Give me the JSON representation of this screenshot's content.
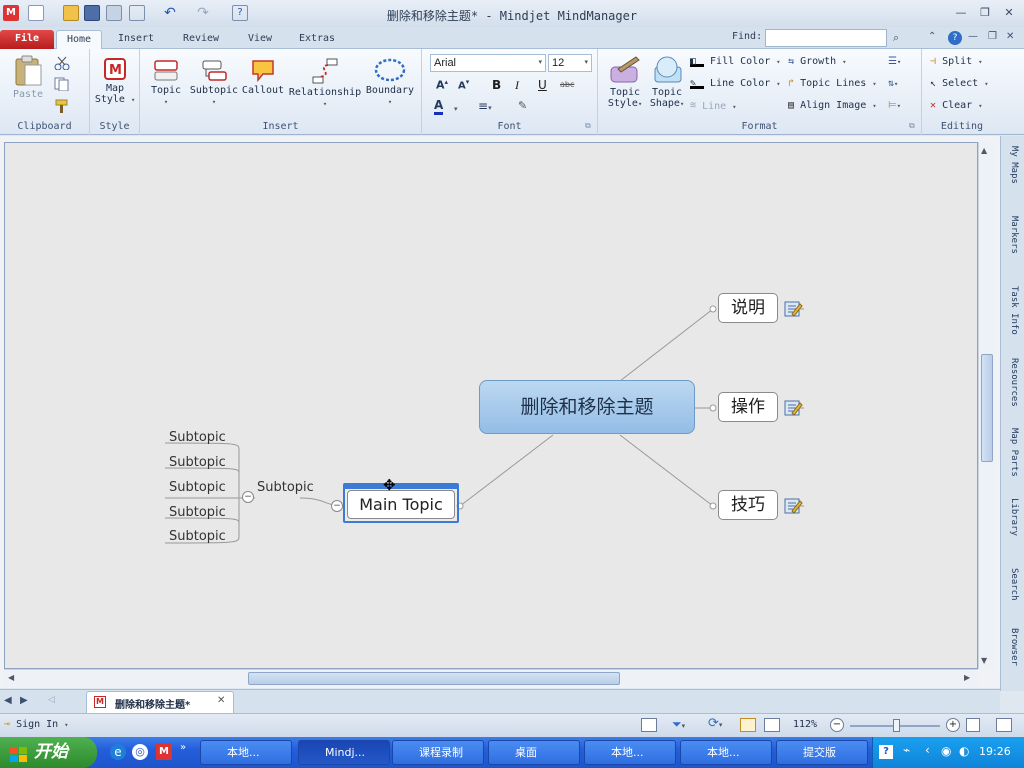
{
  "titlebar": {
    "title": "删除和移除主题* - Mindjet MindManager"
  },
  "tabs": [
    "File",
    "Home",
    "Insert",
    "Review",
    "View",
    "Extras"
  ],
  "find": {
    "label": "Find:",
    "value": ""
  },
  "ribbon": {
    "clipboard": {
      "label": "Clipboard",
      "paste": "Paste"
    },
    "style": {
      "label": "Style",
      "map_style": "Map Style"
    },
    "insert": {
      "label": "Insert",
      "buttons": [
        "Topic",
        "Subtopic",
        "Callout",
        "Relationship",
        "Boundary"
      ]
    },
    "font": {
      "label": "Font",
      "family": "Arial",
      "size": "12"
    },
    "format": {
      "label": "Format",
      "topic_style": "Topic Style",
      "topic_shape": "Topic Shape",
      "fill_color": "Fill Color",
      "line_color": "Line Color",
      "line": "Line",
      "growth": "Growth",
      "topic_lines": "Topic Lines",
      "align_image": "Align Image"
    },
    "editing": {
      "label": "Editing",
      "split": "Split",
      "select": "Select",
      "clear": "Clear"
    }
  },
  "map": {
    "central": "删除和移除主题",
    "main_topics": [
      "说明",
      "操作",
      "技巧"
    ],
    "main_topic": "Main Topic",
    "subtopic": "Subtopic",
    "sub_subtopics": [
      "Subtopic",
      "Subtopic",
      "Subtopic",
      "Subtopic",
      "Subtopic"
    ]
  },
  "side_panel": [
    "My Maps",
    "Markers",
    "Task Info",
    "Resources",
    "Map Parts",
    "Library",
    "Search",
    "Browser"
  ],
  "doc_tab": {
    "label": "删除和移除主题*"
  },
  "status": {
    "sign_in": "Sign In",
    "zoom": "112%"
  },
  "taskbar": {
    "start": "开始",
    "items": [
      "本地...",
      "Mindj...",
      "课程录制",
      "桌面",
      "本地...",
      "本地...",
      "提交版"
    ],
    "clock": "19:26"
  },
  "colors": {
    "accent": "#1e5acc",
    "central_fill": "#a9cbeb",
    "file_tab": "#c42b2b"
  }
}
